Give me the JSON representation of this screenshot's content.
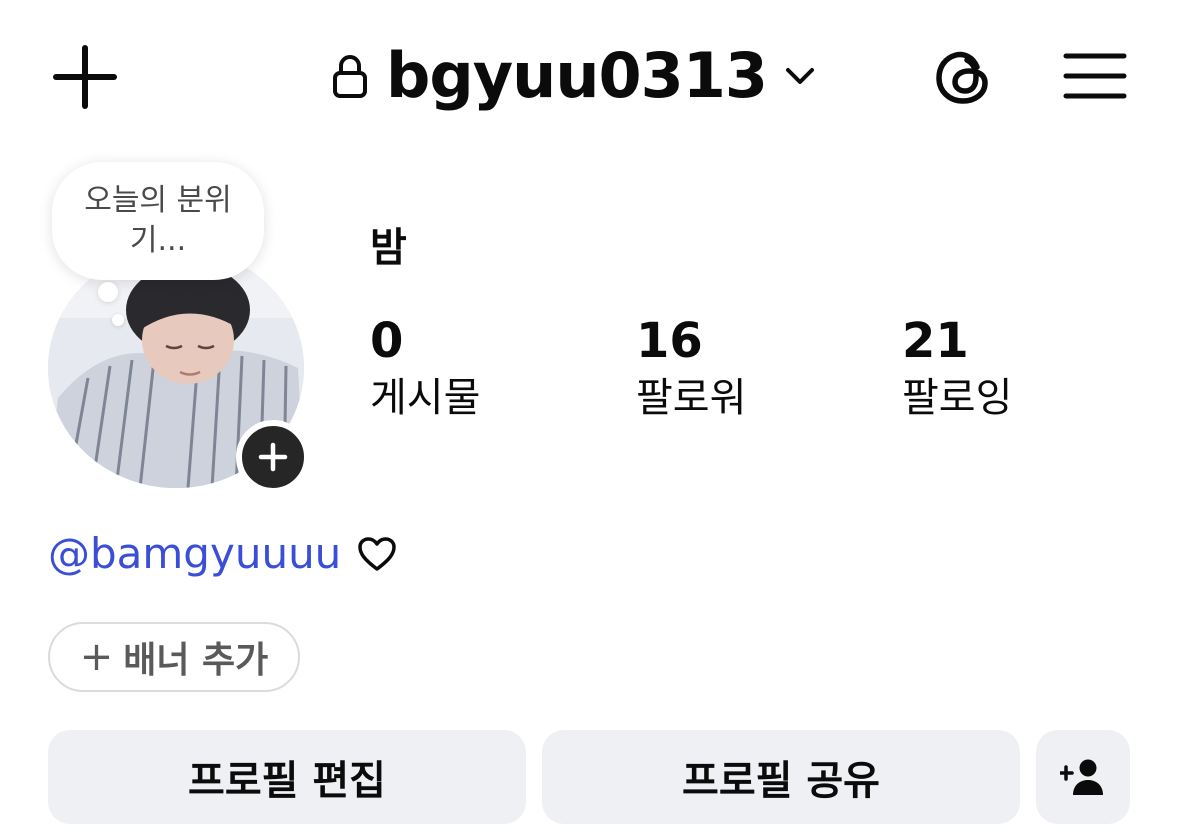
{
  "header": {
    "username": "bgyuu0313",
    "icons": [
      "plus-icon",
      "lock-icon",
      "chevron-down-icon",
      "threads-icon",
      "menu-icon"
    ]
  },
  "profile": {
    "note_line1": "오늘의 분위",
    "note_line2": "기...",
    "display_name": "밤",
    "threads_handle": "@bamgyuuuu",
    "stats": {
      "posts_count": "0",
      "posts_label": "게시물",
      "followers_count": "16",
      "followers_label": "팔로워",
      "following_count": "21",
      "following_label": "팔로잉"
    }
  },
  "buttons": {
    "add_banner_plus": "+",
    "add_banner": "배너 추가",
    "edit_profile": "프로필 편집",
    "share_profile": "프로필 공유"
  },
  "colors": {
    "accent_link": "#3a4fd6",
    "button_bg": "#eff0f4",
    "dark_badge": "#262626"
  }
}
